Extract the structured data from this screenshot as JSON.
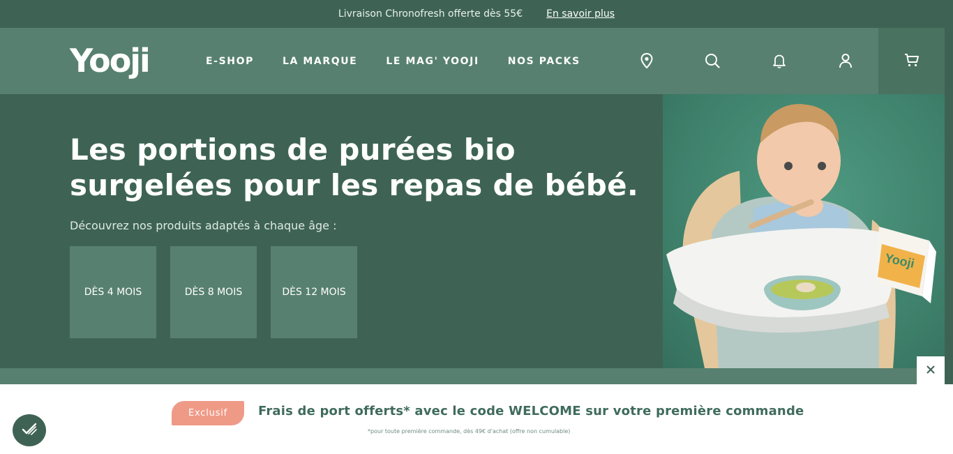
{
  "topbar": {
    "promo_text": "Livraison Chronofresh offerte dès 55€",
    "promo_link": "En savoir plus"
  },
  "header": {
    "logo": "Yooji",
    "nav": [
      "E-SHOP",
      "LA MARQUE",
      "LE MAG' YOOJI",
      "NOS PACKS"
    ],
    "icons": [
      "location-pin-icon",
      "search-icon",
      "bell-icon",
      "user-icon",
      "cart-icon"
    ]
  },
  "hero": {
    "title": "Les portions de purées bio surgelées pour les repas de bébé.",
    "subtitle": "Découvrez nos produits adaptés à chaque âge :",
    "age_buttons": [
      "DÈS 4 MOIS",
      "DÈS 8 MOIS",
      "DÈS 12 MOIS"
    ],
    "image": "baby-in-high-chair-with-yooji-box",
    "box_brand": "Yooji"
  },
  "banner": {
    "badge": "Exclusif",
    "offer": "Frais de port offerts* avec le code WELCOME sur votre première commande",
    "fine_print": "*pour toute première commande, dès 49€ d'achat (offre non cumulable)"
  },
  "colors": {
    "dark_green": "#3e6354",
    "mid_green": "#578070",
    "accent_peach": "#ef9a87",
    "offer_text": "#3f6b5c"
  }
}
